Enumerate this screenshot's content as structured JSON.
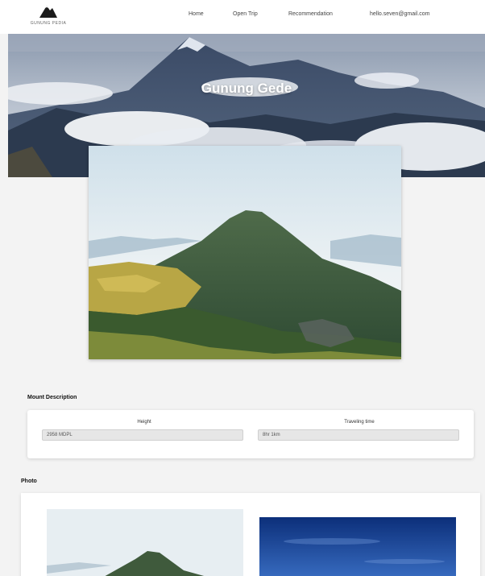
{
  "brand": {
    "logo_text": "GUNUNG PEDIA",
    "logo_icon": "mountain-icon"
  },
  "nav": {
    "items": [
      {
        "label": "Home"
      },
      {
        "label": "Open Trip"
      },
      {
        "label": "Recommendation"
      },
      {
        "label": "hello.seven@gmail.com"
      }
    ]
  },
  "hero": {
    "title": "Gunung Gede"
  },
  "description": {
    "heading": "Mount Description",
    "height_label": "Height",
    "height_value": "2958 MDPL",
    "time_label": "Traveling time",
    "time_value": "8hr 1km"
  },
  "photo": {
    "heading": "Photo"
  },
  "colors": {
    "background": "#f3f3f3",
    "card": "#ffffff",
    "input_bg": "#e6e6e6"
  }
}
